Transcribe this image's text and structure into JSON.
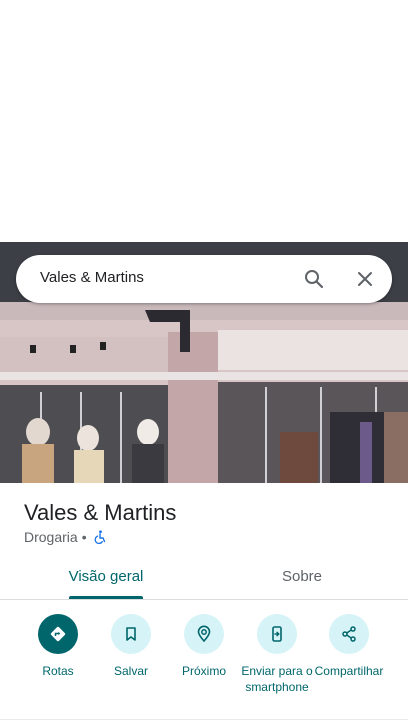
{
  "search": {
    "query": "Vales & Martins"
  },
  "place": {
    "name": "Vales & Martins",
    "category": "Drogaria",
    "separator": "•"
  },
  "tabs": [
    {
      "label": "Visão geral",
      "selected": true
    },
    {
      "label": "Sobre",
      "selected": false
    }
  ],
  "actions": [
    {
      "label": "Rotas",
      "icon": "directions-icon"
    },
    {
      "label": "Salvar",
      "icon": "bookmark-icon"
    },
    {
      "label": "Próximo",
      "icon": "nearby-icon"
    },
    {
      "label": "Enviar para o smartphone",
      "icon": "send-to-phone-icon"
    },
    {
      "label": "Compartilhar",
      "icon": "share-icon"
    }
  ],
  "colors": {
    "accent": "#00666b",
    "action_bg": "#d6f4f7",
    "text": "#202124",
    "secondary_text": "#5f6368",
    "accessibility_icon": "#1a73e8"
  }
}
